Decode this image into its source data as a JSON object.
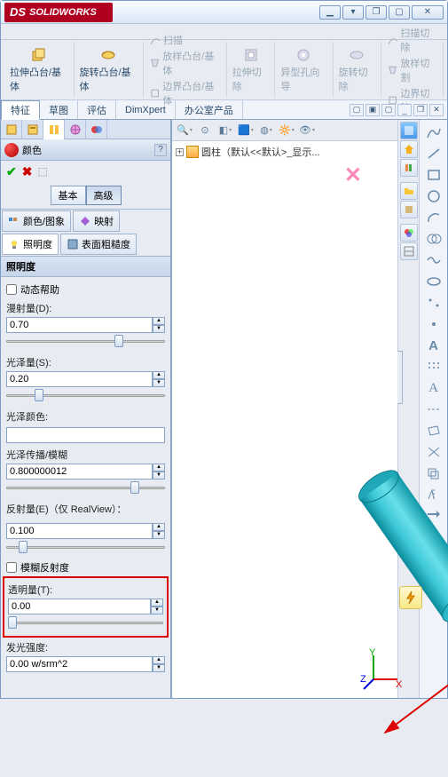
{
  "app": {
    "name": "SOLIDWORKS",
    "ds": "DS"
  },
  "win": {
    "min": "▁",
    "max": "▢",
    "rest": "❐",
    "close": "✕",
    "down": "▾"
  },
  "ribbon": {
    "extrude_boss": "拉伸凸台/基体",
    "revolve_boss": "旋转凸台/基体",
    "sweep": "扫描",
    "loft": "放样凸台/基体",
    "boundary": "边界凸台/基体",
    "extrude_cut": "拉伸切除",
    "hole": "异型孔向导",
    "revolve_cut": "旋转切除",
    "sweep_cut": "扫描切除",
    "loft_cut": "放样切割",
    "boundary_cut": "边界切除"
  },
  "tabs": {
    "feature": "特征",
    "sketch": "草图",
    "eval": "评估",
    "dimx": "DimXpert",
    "office": "办公室产品"
  },
  "color_pane": {
    "title": "颜色",
    "basic": "基本",
    "advanced": "高级",
    "color_img": "颜色/图象",
    "map": "映射",
    "illum": "照明度",
    "rough": "表面粗糙度"
  },
  "illum": {
    "header": "照明度",
    "dyn_help": "动态帮助",
    "diffuse_l": "漫射量(D):",
    "diffuse_v": "0.70",
    "spec_l": "光泽量(S):",
    "spec_v": "0.20",
    "spec_color_l": "光泽颜色:",
    "spec_color_v": "",
    "spec_spread_l": "光泽传播/模糊",
    "spec_spread_v": "0.800000012",
    "refl_l": "反射量(E)（仅 RealView）：",
    "refl_v": "0.100",
    "blur_refl": "模糊反射度",
    "trans_l": "透明量(T):",
    "trans_v": "0.00",
    "lum_l": "发光强度:",
    "lum_v": "0.00 w/srm^2"
  },
  "tree": {
    "root": "圆柱（默认<<默认>_显示..."
  },
  "triad": {
    "x": "X",
    "y": "Y",
    "z": "Z"
  }
}
